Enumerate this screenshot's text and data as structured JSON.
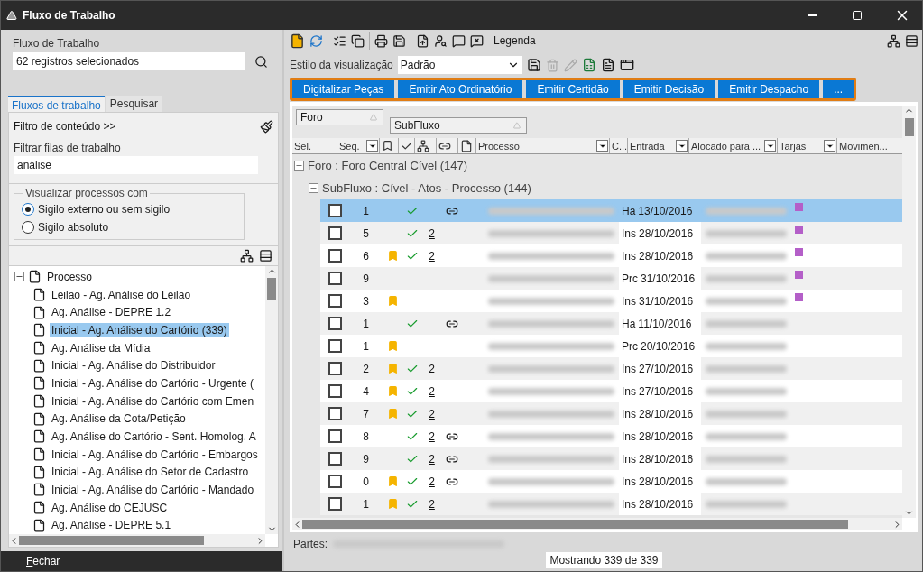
{
  "window": {
    "title": "Fluxo de Trabalho"
  },
  "left_panel": {
    "workflow_label": "Fluxo de Trabalho",
    "workflow_value": "62 registros selecionados",
    "tabs": [
      {
        "label": "Fluxos de trabalho",
        "selected": true
      },
      {
        "label": "Pesquisar",
        "selected": false
      }
    ],
    "content_filter": "Filtro de conteúdo >>",
    "queue_filter_label": "Filtrar filas de trabalho",
    "queue_filter_value": "análise",
    "visibility": {
      "legend": "Visualizar processos com",
      "options": [
        {
          "label": "Sigilo externo ou sem sigilo",
          "selected": true
        },
        {
          "label": "Sigilo absoluto",
          "selected": false
        }
      ]
    },
    "tree": {
      "label": "Processo",
      "expanded": true,
      "children": [
        {
          "label": "Leilão - Ag. Análise do Leilão",
          "selected": false
        },
        {
          "label": "Ag. Análise - DEPRE 1.2",
          "selected": false
        },
        {
          "label": "Inicial - Ag. Análise do Cartório (339)",
          "selected": true
        },
        {
          "label": "Ag. Análise da Mídia",
          "selected": false
        },
        {
          "label": "Inicial  - Ag. Análise do Distribuidor",
          "selected": false
        },
        {
          "label": "Inicial - Ag. Análise do Cartório - Urgente (",
          "selected": false
        },
        {
          "label": "Inicial - Ag. Análise do Cartório com Emen",
          "selected": false
        },
        {
          "label": "Ag. Análise da Cota/Petição",
          "selected": false
        },
        {
          "label": "Ag. Análise do Cartório - Sent. Homolog. A",
          "selected": false
        },
        {
          "label": "Inicial - Ag. Análise do Cartório - Embargos",
          "selected": false
        },
        {
          "label": "Inicial - Ag. Análise do Setor de Cadastro",
          "selected": false
        },
        {
          "label": "Inicial - Ag. Análise do Cartório - Mandado",
          "selected": false
        },
        {
          "label": "Ag. Análise do CEJUSC",
          "selected": false
        },
        {
          "label": "Ag. Análise - DEPRE 5.1",
          "selected": false
        }
      ]
    },
    "close_button": "Fechar"
  },
  "toolbar": {
    "legend_label": "Legenda",
    "view_style_label": "Estilo da visualização",
    "view_style_value": "Padrão"
  },
  "actions": [
    "Digitalizar Peças",
    "Emitir Ato Ordinatório",
    "Emitir Certidão",
    "Emitir Decisão",
    "Emitir Despacho",
    "..."
  ],
  "grouping": [
    "Foro",
    "SubFluxo"
  ],
  "grid": {
    "columns": [
      {
        "kind": "text",
        "label": "Sel.",
        "filter": false
      },
      {
        "kind": "text",
        "label": "Seq.",
        "filter": true
      },
      {
        "kind": "flag"
      },
      {
        "kind": "check"
      },
      {
        "kind": "tree"
      },
      {
        "kind": "link"
      },
      {
        "kind": "doc"
      },
      {
        "kind": "text",
        "label": "Processo",
        "filter": true
      },
      {
        "kind": "text",
        "label": "C...",
        "filter": false
      },
      {
        "kind": "text",
        "label": "Entrada",
        "filter": true
      },
      {
        "kind": "text",
        "label": "Alocado para ...",
        "filter": true
      },
      {
        "kind": "text",
        "label": "Tarjas",
        "filter": true
      },
      {
        "kind": "text",
        "label": "Movimen...",
        "filter": false
      }
    ],
    "group": {
      "label": "Foro : Foro Central Cível  (147)",
      "expanded": true
    },
    "subgroup": {
      "label": "SubFluxo : Cível - Atos - Processo  (144)",
      "expanded": true
    },
    "rows": [
      {
        "seq": "1",
        "checked": false,
        "flagged": false,
        "done": true,
        "count": "",
        "linked": true,
        "prefix": "Ha",
        "date": "13/10/2016",
        "tarja": true,
        "selected": true
      },
      {
        "seq": "5",
        "checked": false,
        "flagged": false,
        "done": true,
        "count": "2",
        "linked": false,
        "prefix": "Ins",
        "date": "28/10/2016",
        "tarja": true,
        "selected": false
      },
      {
        "seq": "6",
        "checked": false,
        "flagged": true,
        "done": true,
        "count": "2",
        "linked": false,
        "prefix": "Ins",
        "date": "28/10/2016",
        "tarja": true,
        "selected": false
      },
      {
        "seq": "9",
        "checked": false,
        "flagged": false,
        "done": false,
        "count": "",
        "linked": false,
        "prefix": "Prc",
        "date": "31/10/2016",
        "tarja": true,
        "selected": false
      },
      {
        "seq": "3",
        "checked": false,
        "flagged": true,
        "done": false,
        "count": "",
        "linked": false,
        "prefix": "Ins",
        "date": "31/10/2016",
        "tarja": true,
        "selected": false
      },
      {
        "seq": "1",
        "checked": false,
        "flagged": false,
        "done": true,
        "count": "",
        "linked": true,
        "prefix": "Ha",
        "date": "11/10/2016",
        "tarja": false,
        "selected": false
      },
      {
        "seq": "1",
        "checked": false,
        "flagged": true,
        "done": false,
        "count": "",
        "linked": false,
        "prefix": "Prc",
        "date": "20/10/2016",
        "tarja": false,
        "selected": false
      },
      {
        "seq": "2",
        "checked": false,
        "flagged": true,
        "done": true,
        "count": "2",
        "linked": false,
        "prefix": "Ins",
        "date": "27/10/2016",
        "tarja": false,
        "selected": false
      },
      {
        "seq": "4",
        "checked": false,
        "flagged": true,
        "done": true,
        "count": "2",
        "linked": false,
        "prefix": "Ins",
        "date": "27/10/2016",
        "tarja": false,
        "selected": false
      },
      {
        "seq": "7",
        "checked": false,
        "flagged": true,
        "done": true,
        "count": "2",
        "linked": false,
        "prefix": "Ins",
        "date": "28/10/2016",
        "tarja": false,
        "selected": false
      },
      {
        "seq": "8",
        "checked": false,
        "flagged": false,
        "done": true,
        "count": "2",
        "linked": true,
        "prefix": "Ins",
        "date": "28/10/2016",
        "tarja": false,
        "selected": false
      },
      {
        "seq": "9",
        "checked": false,
        "flagged": false,
        "done": true,
        "count": "2",
        "linked": true,
        "prefix": "Ins",
        "date": "28/10/2016",
        "tarja": false,
        "selected": false
      },
      {
        "seq": "0",
        "checked": false,
        "flagged": true,
        "done": true,
        "count": "2",
        "linked": true,
        "prefix": "Ins",
        "date": "28/10/2016",
        "tarja": false,
        "selected": false
      },
      {
        "seq": "1",
        "checked": false,
        "flagged": true,
        "done": true,
        "count": "2",
        "linked": false,
        "prefix": "Ins",
        "date": "28/10/2016",
        "tarja": false,
        "selected": false
      }
    ]
  },
  "footer": {
    "parts_label": "Partes:",
    "status": "Mostrando 339 de 339"
  }
}
